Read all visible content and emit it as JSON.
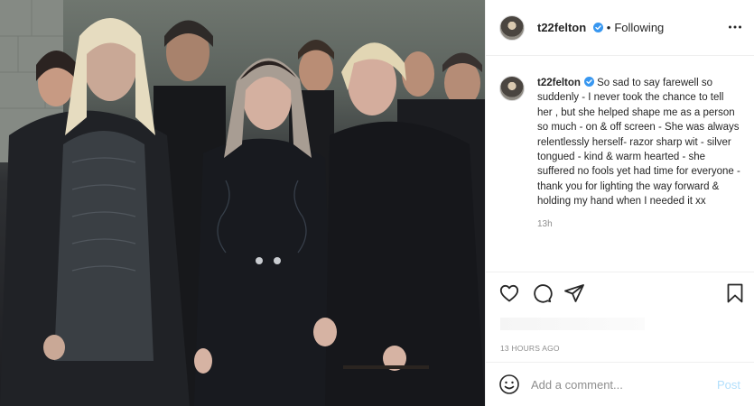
{
  "photo": {
    "description_icon": "post-photo"
  },
  "header": {
    "username": "t22felton",
    "separator": "•",
    "follow_state": "Following",
    "more_icon": "ellipsis-icon"
  },
  "caption": {
    "username": "t22felton",
    "text": "So sad to say farewell so suddenly - I never took the chance to tell her , but she helped shape me as a person so much - on & off screen - She was always relentlessly herself- razor sharp wit - silver tongued - kind & warm hearted - she suffered no fools yet had time for everyone - thank you for lighting the way forward & holding my hand when I needed it xx",
    "time": "13h"
  },
  "actions": {
    "like_icon": "heart-icon",
    "comment_icon": "comment-icon",
    "share_icon": "share-icon",
    "save_icon": "bookmark-icon"
  },
  "meta": {
    "date": "13 HOURS AGO"
  },
  "comment_box": {
    "placeholder": "Add a comment...",
    "post_label": "Post",
    "emoji_icon": "smiley-icon"
  },
  "colors": {
    "verified_blue": "#3897f0",
    "post_disabled": "#b2dffc",
    "text": "#262626",
    "muted": "#8e8e8e",
    "divider": "#efefef"
  }
}
